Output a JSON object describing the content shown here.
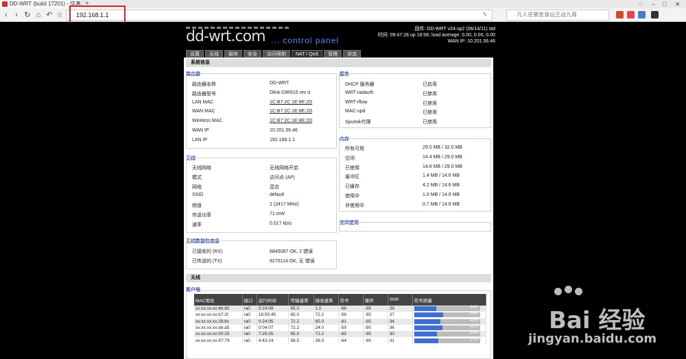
{
  "browser": {
    "tab_title": "DD-WRT (build 17201) - 信息",
    "new_tab": "+",
    "url": "192.168.1.1",
    "search_placeholder": "凡人逆袭变身仙王战九霄",
    "nav": {
      "back": "‹",
      "forward": "›",
      "reload": "↻",
      "home": "⌂",
      "undo": "↶",
      "star": "☆"
    }
  },
  "header": {
    "logo": "dd-wrt.com",
    "control_panel": "... control panel",
    "firmware": "固件: DD-WRT v24-sp2 (06/14/11) std",
    "time": "时间: 09:47:28 up 18:58, load average: 0.00, 0.00, 0.00",
    "wan_ip": "WAN IP: 10.201.56.46"
  },
  "tabs": [
    "设置",
    "无线",
    "服务",
    "安全",
    "访问限制",
    "NAT / QoS",
    "管理",
    "状态"
  ],
  "active_tab": 5,
  "section_title": "系统信息",
  "router": {
    "title": "路由器",
    "rows": [
      {
        "label": "路由器名称",
        "value": "DD-WRT"
      },
      {
        "label": "路由器型号",
        "value": "Dlink-DIR615 rev d"
      },
      {
        "label": "LAN MAC",
        "value": "1C:B7:2C:1E:8E:2D"
      },
      {
        "label": "WAN MAC",
        "value": "1C:B7:2C:1E:8E:2D"
      },
      {
        "label": "Wireless MAC",
        "value": "1C:B7:2C:1E:8E:2D"
      },
      {
        "label": "WAN IP",
        "value": "10.201.56.46"
      },
      {
        "label": "LAN IP",
        "value": "192.168.1.1"
      }
    ]
  },
  "services": {
    "title": "服务",
    "rows": [
      {
        "label": "DHCP 服务器",
        "value": "已启用"
      },
      {
        "label": "WRT-radauth",
        "value": "已禁用"
      },
      {
        "label": "WRT-rflow",
        "value": "已禁用"
      },
      {
        "label": "MAC-upd",
        "value": "已禁用"
      },
      {
        "label": "Sputnik代理",
        "value": "已禁用"
      }
    ]
  },
  "memory": {
    "title": "内存",
    "rows": [
      {
        "label": "所有可用",
        "value": "29.0 MB / 32.0 MB"
      },
      {
        "label": "空闲",
        "value": "14.4 MB / 29.0 MB"
      },
      {
        "label": "已使用",
        "value": "14.6 MB / 29.0 MB"
      },
      {
        "label": "缓冲区",
        "value": "1.4 MB / 14.6 MB"
      },
      {
        "label": "已缓存",
        "value": "4.2 MB / 14.6 MB"
      },
      {
        "label": "使用中",
        "value": "1.0 MB / 14.6 MB"
      },
      {
        "label": "非使用中",
        "value": "0.7 MB / 14.6 MB"
      }
    ]
  },
  "space": {
    "title": "空间使用"
  },
  "wireless": {
    "title": "无线",
    "rows": [
      {
        "label": "无线网络",
        "value": "无线网络开启"
      },
      {
        "label": "模式",
        "value": "访问点 (AP)"
      },
      {
        "label": "网络",
        "value": "混合"
      },
      {
        "label": "SSID",
        "value": "default"
      },
      {
        "label": "频道",
        "value": "2 (2417 MHz)"
      },
      {
        "label": "传送功率",
        "value": "71 mW"
      },
      {
        "label": "速率",
        "value": "0.017 kb/s"
      }
    ]
  },
  "wireless_packets": {
    "title": "无线数据包信息",
    "rows": [
      {
        "label": "已接收的 (RX)",
        "value": "6845087 OK, 2 错误"
      },
      {
        "label": "已传送的 (TX)",
        "value": "9270114 OK, 无 错误"
      }
    ]
  },
  "wireless_bar": "无线",
  "clients": {
    "title": "客户端",
    "headers": [
      "MAC地址",
      "接口",
      "运行时间",
      "传输速率",
      "接收速率",
      "信号",
      "噪声",
      "SNR",
      "信号质量"
    ],
    "rows": [
      {
        "mac": "xx:xx:xx:xx:4b:80",
        "iface": "ra0",
        "uptime": "0:24:08",
        "tx": "65.0",
        "rx": "1.0",
        "signal": "-66",
        "noise": "-95",
        "snr": "29",
        "quality": 34,
        "quality_label": "34%"
      },
      {
        "mac": "xx:xx:xx:xx:b7:2f",
        "iface": "ra0",
        "uptime": "18:55:45",
        "tx": "65.0",
        "rx": "72.2",
        "signal": "-58",
        "noise": "-95",
        "snr": "37",
        "quality": 44,
        "quality_label": "44%"
      },
      {
        "mac": "xx:xx:xx:xx:28:8c",
        "iface": "ra0",
        "uptime": "0:24:05",
        "tx": "72.2",
        "rx": "65.0",
        "signal": "-61",
        "noise": "-95",
        "snr": "34",
        "quality": 40,
        "quality_label": "40%"
      },
      {
        "mac": "xx:xx:xx:xx:de:a5",
        "iface": "ra0",
        "uptime": "0:04:07",
        "tx": "72.2",
        "rx": "24.0",
        "signal": "-59",
        "noise": "-95",
        "snr": "36",
        "quality": 43,
        "quality_label": "43%"
      },
      {
        "mac": "xx:xx:xx:xx:00:25",
        "iface": "ra0",
        "uptime": "7:25:05",
        "tx": "65.0",
        "rx": "72.2",
        "signal": "-65",
        "noise": "-95",
        "snr": "30",
        "quality": 35,
        "quality_label": "35%"
      },
      {
        "mac": "xx:xx:xx:xx:47:79",
        "iface": "ra0",
        "uptime": "4:43:24",
        "tx": "58.5",
        "rx": "26.0",
        "signal": "-64",
        "noise": "-95",
        "snr": "31",
        "quality": 37,
        "quality_label": "37%"
      }
    ]
  },
  "watermark": {
    "brand": "Bai 经验",
    "url": "jingyan.baidu.com"
  }
}
